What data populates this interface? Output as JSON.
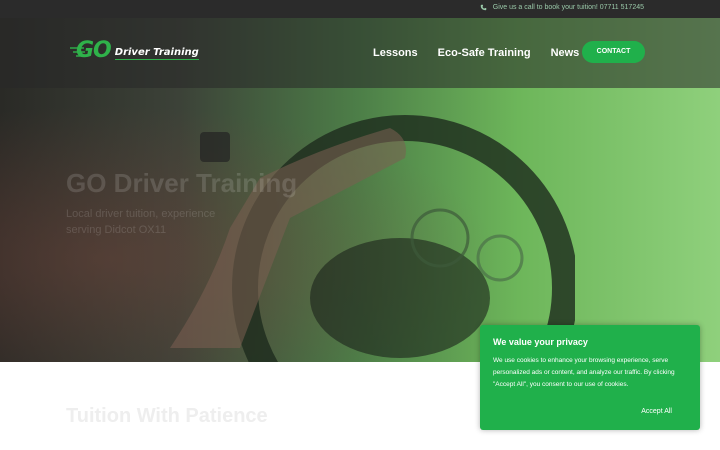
{
  "topbar": {
    "contact_text": "Give us a call to book your tuition! 07711 517245"
  },
  "logo": {
    "mark": "GO",
    "text": "Driver Training"
  },
  "nav": {
    "items": [
      "Lessons",
      "Eco-Safe Training",
      "News"
    ],
    "contact_button": "CONTACT"
  },
  "hero": {
    "title": "GO Driver Training",
    "subtitle_line1": "Local driver tuition, experience",
    "subtitle_line2": "serving Didcot OX11"
  },
  "main": {
    "section_title": "Tuition With Patience"
  },
  "cookie_banner": {
    "title": "We value your privacy",
    "body": "We use cookies to enhance your browsing experience, serve personalized ads or content, and analyze our traffic. By clicking \"Accept All\", you consent to our use of cookies.",
    "accept_label": "Accept All"
  },
  "colors": {
    "brand_green": "#20b04b",
    "topbar": "#2b2b2b"
  }
}
